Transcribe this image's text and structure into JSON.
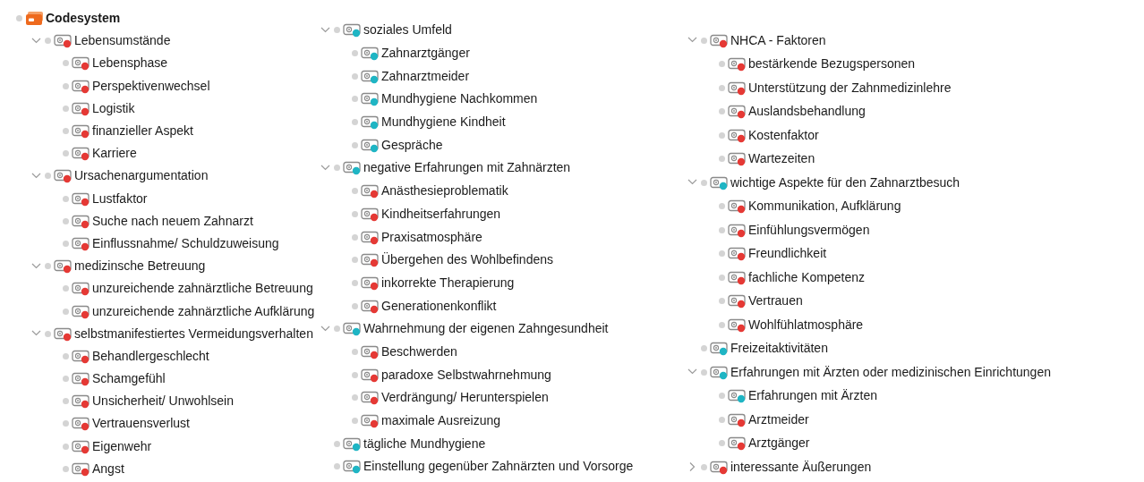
{
  "code_system": {
    "title": "Codesystem",
    "columns": [
      {
        "codes": [
          {
            "label": "Lebensumstände",
            "color": "#e53935",
            "expanded": true,
            "children": [
              {
                "label": "Lebensphase",
                "color": "#e53935"
              },
              {
                "label": "Perspektivenwechsel",
                "color": "#e53935"
              },
              {
                "label": "Logistik",
                "color": "#e53935"
              },
              {
                "label": "finanzieller Aspekt",
                "color": "#e53935"
              },
              {
                "label": "Karriere",
                "color": "#e53935"
              }
            ]
          },
          {
            "label": "Ursachenargumentation",
            "color": "#e53935",
            "expanded": true,
            "children": [
              {
                "label": "Lustfaktor",
                "color": "#e53935"
              },
              {
                "label": "Suche nach neuem Zahnarzt",
                "color": "#e53935"
              },
              {
                "label": "Einflussnahme/ Schuldzuweisung",
                "color": "#e53935"
              }
            ]
          },
          {
            "label": "medizinsche Betreuung",
            "color": "#e53935",
            "expanded": true,
            "children": [
              {
                "label": "unzureichende zahnärztliche Betreuung",
                "color": "#e53935"
              },
              {
                "label": "unzureichende zahnärztliche Aufklärung",
                "color": "#e53935"
              }
            ]
          },
          {
            "label": "selbstmanifestiertes Vermeidungsverhalten",
            "color": "#e53935",
            "expanded": true,
            "children": [
              {
                "label": "Behandlergeschlecht",
                "color": "#e53935"
              },
              {
                "label": "Schamgefühl",
                "color": "#e53935"
              },
              {
                "label": "Unsicherheit/ Unwohlsein",
                "color": "#e53935"
              },
              {
                "label": "Vertrauensverlust",
                "color": "#e53935"
              },
              {
                "label": "Eigenwehr",
                "color": "#e53935"
              },
              {
                "label": "Angst",
                "color": "#e53935"
              }
            ]
          }
        ]
      },
      {
        "codes": [
          {
            "label": "soziales Umfeld",
            "color": "#1fb5c4",
            "expanded": true,
            "children": [
              {
                "label": "Zahnarztgänger",
                "color": "#1fb5c4"
              },
              {
                "label": "Zahnarztmeider",
                "color": "#1fb5c4"
              },
              {
                "label": "Mundhygiene Nachkommen",
                "color": "#1fb5c4"
              },
              {
                "label": "Mundhygiene Kindheit",
                "color": "#1fb5c4"
              },
              {
                "label": "Gespräche",
                "color": "#1fb5c4"
              }
            ]
          },
          {
            "label": "negative Erfahrungen mit Zahnärzten",
            "color": "#1fb5c4",
            "expanded": true,
            "children": [
              {
                "label": "Anästhesieproblematik",
                "color": "#e53935"
              },
              {
                "label": "Kindheitserfahrungen",
                "color": "#e53935"
              },
              {
                "label": "Praxisatmosphäre",
                "color": "#e53935"
              },
              {
                "label": "Übergehen des Wohlbefindens",
                "color": "#e53935"
              },
              {
                "label": "inkorrekte Therapierung",
                "color": "#e53935"
              },
              {
                "label": "Generationenkonflikt",
                "color": "#e53935"
              }
            ]
          },
          {
            "label": "Wahrnehmung der eigenen Zahngesundheit",
            "color": "#1fb5c4",
            "expanded": true,
            "children": [
              {
                "label": "Beschwerden",
                "color": "#e53935"
              },
              {
                "label": "paradoxe Selbstwahrnehmung",
                "color": "#e53935"
              },
              {
                "label": "Verdrängung/ Herunterspielen",
                "color": "#e53935"
              },
              {
                "label": "maximale Ausreizung",
                "color": "#e53935"
              }
            ]
          },
          {
            "label": "tägliche Mundhygiene",
            "color": "#1fb5c4"
          },
          {
            "label": "Einstellung gegenüber Zahnärzten und Vorsorge",
            "color": "#1fb5c4"
          }
        ]
      },
      {
        "codes": [
          {
            "label": "NHCA - Faktoren",
            "color": "#e53935",
            "expanded": true,
            "children": [
              {
                "label": "bestärkende Bezugspersonen",
                "color": "#e53935"
              },
              {
                "label": "Unterstützung der Zahnmedizinlehre",
                "color": "#e53935"
              },
              {
                "label": "Auslandsbehandlung",
                "color": "#e53935"
              },
              {
                "label": "Kostenfaktor",
                "color": "#e53935"
              },
              {
                "label": "Wartezeiten",
                "color": "#e53935"
              }
            ]
          },
          {
            "label": "wichtige Aspekte für den Zahnarztbesuch",
            "color": "#1fb5c4",
            "expanded": true,
            "children": [
              {
                "label": "Kommunikation, Aufklärung",
                "color": "#e53935"
              },
              {
                "label": "Einfühlungsvermögen",
                "color": "#e53935"
              },
              {
                "label": "Freundlichkeit",
                "color": "#e53935"
              },
              {
                "label": "fachliche Kompetenz",
                "color": "#e53935"
              },
              {
                "label": "Vertrauen",
                "color": "#e53935"
              },
              {
                "label": "Wohlfühlatmosphäre",
                "color": "#e53935"
              }
            ]
          },
          {
            "label": "Freizeitaktivitäten",
            "color": "#1fb5c4"
          },
          {
            "label": "Erfahrungen mit Ärzten oder medizinischen Einrichtungen",
            "color": "#1fb5c4",
            "expanded": true,
            "children": [
              {
                "label": "Erfahrungen mit Ärzten",
                "color": "#1fb5c4"
              },
              {
                "label": "Arztmeider",
                "color": "#e53935"
              },
              {
                "label": "Arztgänger",
                "color": "#e53935"
              }
            ]
          },
          {
            "label": "interessante Äußerungen",
            "color": "#e53935",
            "expanded": false
          }
        ]
      }
    ]
  }
}
